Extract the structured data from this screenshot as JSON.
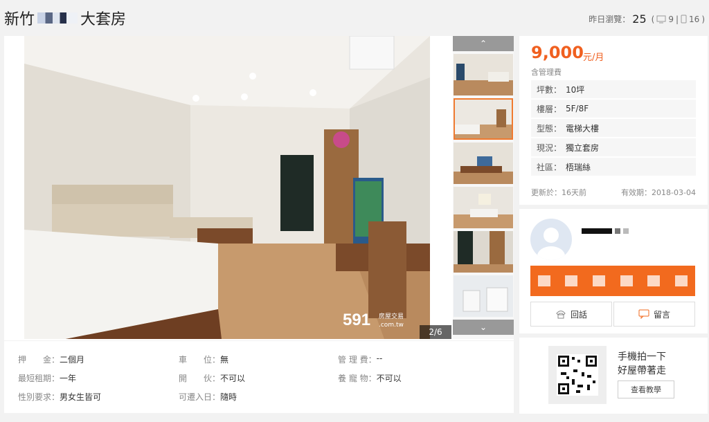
{
  "header": {
    "title_left": "新竹",
    "title_right": "大套房",
    "views_label": "昨日瀏覽：",
    "views_count": "25",
    "pc_count": "9",
    "mobile_count": "16"
  },
  "gallery": {
    "page_indicator": "2/6",
    "watermark_num": "591",
    "watermark_site": ".com.tw",
    "watermark_text": "房屋交易",
    "up_arrow": "⌃",
    "down_arrow": "⌄"
  },
  "price": {
    "amount": "9,000",
    "unit": "元/月",
    "fee_note": "含管理費"
  },
  "attributes": [
    {
      "key": "坪數：",
      "value": "10坪"
    },
    {
      "key": "樓層：",
      "value": "5F/8F"
    },
    {
      "key": "型態：",
      "value": "電梯大樓"
    },
    {
      "key": "現況：",
      "value": "獨立套房"
    },
    {
      "key": "社區：",
      "value": "梧瑞絲"
    }
  ],
  "update": {
    "updated": "更新於：16天前",
    "expire": "有效期：2018-03-04"
  },
  "owner": {
    "call_label": "回話",
    "message_label": "留言"
  },
  "qr": {
    "line1": "手機拍一下",
    "line2": "好屋帶著走",
    "button": "查看教學"
  },
  "details": [
    {
      "label": "押　　金：",
      "value": "二個月"
    },
    {
      "label": "車　　位：",
      "value": "無"
    },
    {
      "label": "管 理 費：",
      "value": "--"
    },
    {
      "label": "最短租期：",
      "value": "一年"
    },
    {
      "label": "開　　伙：",
      "value": "不可以"
    },
    {
      "label": "養 寵 物：",
      "value": "不可以"
    },
    {
      "label": "性別要求：",
      "value": "男女生皆可"
    },
    {
      "label": "可遷入日：",
      "value": "隨時"
    }
  ],
  "colors": {
    "accent": "#f26a1e",
    "price": "#f06020"
  }
}
